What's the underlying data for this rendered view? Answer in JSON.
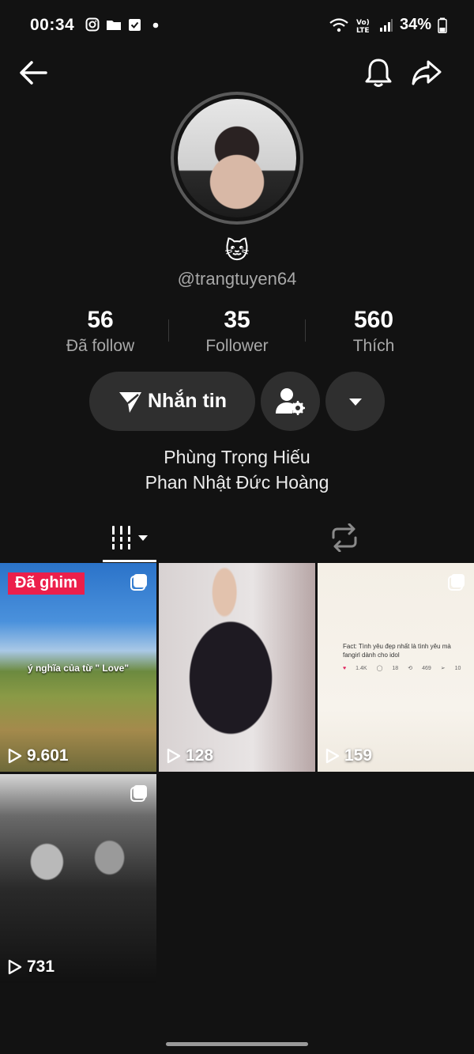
{
  "status_bar": {
    "time": "00:34",
    "battery": "34%",
    "icons": [
      "instagram-icon",
      "folder-icon",
      "checkbox-icon",
      "dot-icon",
      "wifi-icon",
      "volte-icon",
      "signal-icon",
      "battery-icon"
    ]
  },
  "topbar": {
    "icons": [
      "back-arrow-icon",
      "bell-icon",
      "share-icon"
    ]
  },
  "profile": {
    "emoji": "🐱",
    "handle": "@trangtuyen64",
    "stats": [
      {
        "value": "56",
        "label": "Đã follow"
      },
      {
        "value": "35",
        "label": "Follower"
      },
      {
        "value": "560",
        "label": "Thích"
      }
    ],
    "message_button": "Nhắn tin",
    "bio_lines": [
      "Phùng Trọng Hiếu",
      "Phan Nhật Đức Hoàng"
    ]
  },
  "videos": [
    {
      "views": "9.601",
      "pinned_label": "Đã ghim",
      "caption": "ý nghĩa của từ \" Love\""
    },
    {
      "views": "128"
    },
    {
      "views": "159",
      "fact_text": "Fact: Tình yêu đẹp nhất là tình yêu mà fangirl dành cho idol",
      "likes": "1.4K",
      "comments": "18",
      "reposts": "469",
      "shares": "10"
    },
    {
      "views": "731"
    }
  ],
  "colors": {
    "background": "#121212",
    "button_bg": "#2f2f2f",
    "pinned_badge": "#ec1f4b",
    "secondary_text": "#a8a8a8"
  }
}
